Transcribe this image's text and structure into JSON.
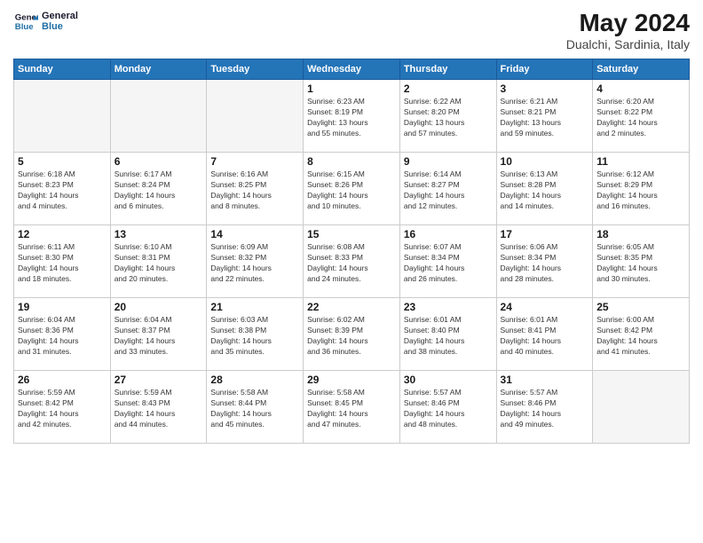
{
  "logo": {
    "line1": "General",
    "line2": "Blue"
  },
  "title": "May 2024",
  "location": "Dualchi, Sardinia, Italy",
  "days_of_week": [
    "Sunday",
    "Monday",
    "Tuesday",
    "Wednesday",
    "Thursday",
    "Friday",
    "Saturday"
  ],
  "weeks": [
    [
      {
        "day": "",
        "info": ""
      },
      {
        "day": "",
        "info": ""
      },
      {
        "day": "",
        "info": ""
      },
      {
        "day": "1",
        "info": "Sunrise: 6:23 AM\nSunset: 8:19 PM\nDaylight: 13 hours\nand 55 minutes."
      },
      {
        "day": "2",
        "info": "Sunrise: 6:22 AM\nSunset: 8:20 PM\nDaylight: 13 hours\nand 57 minutes."
      },
      {
        "day": "3",
        "info": "Sunrise: 6:21 AM\nSunset: 8:21 PM\nDaylight: 13 hours\nand 59 minutes."
      },
      {
        "day": "4",
        "info": "Sunrise: 6:20 AM\nSunset: 8:22 PM\nDaylight: 14 hours\nand 2 minutes."
      }
    ],
    [
      {
        "day": "5",
        "info": "Sunrise: 6:18 AM\nSunset: 8:23 PM\nDaylight: 14 hours\nand 4 minutes."
      },
      {
        "day": "6",
        "info": "Sunrise: 6:17 AM\nSunset: 8:24 PM\nDaylight: 14 hours\nand 6 minutes."
      },
      {
        "day": "7",
        "info": "Sunrise: 6:16 AM\nSunset: 8:25 PM\nDaylight: 14 hours\nand 8 minutes."
      },
      {
        "day": "8",
        "info": "Sunrise: 6:15 AM\nSunset: 8:26 PM\nDaylight: 14 hours\nand 10 minutes."
      },
      {
        "day": "9",
        "info": "Sunrise: 6:14 AM\nSunset: 8:27 PM\nDaylight: 14 hours\nand 12 minutes."
      },
      {
        "day": "10",
        "info": "Sunrise: 6:13 AM\nSunset: 8:28 PM\nDaylight: 14 hours\nand 14 minutes."
      },
      {
        "day": "11",
        "info": "Sunrise: 6:12 AM\nSunset: 8:29 PM\nDaylight: 14 hours\nand 16 minutes."
      }
    ],
    [
      {
        "day": "12",
        "info": "Sunrise: 6:11 AM\nSunset: 8:30 PM\nDaylight: 14 hours\nand 18 minutes."
      },
      {
        "day": "13",
        "info": "Sunrise: 6:10 AM\nSunset: 8:31 PM\nDaylight: 14 hours\nand 20 minutes."
      },
      {
        "day": "14",
        "info": "Sunrise: 6:09 AM\nSunset: 8:32 PM\nDaylight: 14 hours\nand 22 minutes."
      },
      {
        "day": "15",
        "info": "Sunrise: 6:08 AM\nSunset: 8:33 PM\nDaylight: 14 hours\nand 24 minutes."
      },
      {
        "day": "16",
        "info": "Sunrise: 6:07 AM\nSunset: 8:34 PM\nDaylight: 14 hours\nand 26 minutes."
      },
      {
        "day": "17",
        "info": "Sunrise: 6:06 AM\nSunset: 8:34 PM\nDaylight: 14 hours\nand 28 minutes."
      },
      {
        "day": "18",
        "info": "Sunrise: 6:05 AM\nSunset: 8:35 PM\nDaylight: 14 hours\nand 30 minutes."
      }
    ],
    [
      {
        "day": "19",
        "info": "Sunrise: 6:04 AM\nSunset: 8:36 PM\nDaylight: 14 hours\nand 31 minutes."
      },
      {
        "day": "20",
        "info": "Sunrise: 6:04 AM\nSunset: 8:37 PM\nDaylight: 14 hours\nand 33 minutes."
      },
      {
        "day": "21",
        "info": "Sunrise: 6:03 AM\nSunset: 8:38 PM\nDaylight: 14 hours\nand 35 minutes."
      },
      {
        "day": "22",
        "info": "Sunrise: 6:02 AM\nSunset: 8:39 PM\nDaylight: 14 hours\nand 36 minutes."
      },
      {
        "day": "23",
        "info": "Sunrise: 6:01 AM\nSunset: 8:40 PM\nDaylight: 14 hours\nand 38 minutes."
      },
      {
        "day": "24",
        "info": "Sunrise: 6:01 AM\nSunset: 8:41 PM\nDaylight: 14 hours\nand 40 minutes."
      },
      {
        "day": "25",
        "info": "Sunrise: 6:00 AM\nSunset: 8:42 PM\nDaylight: 14 hours\nand 41 minutes."
      }
    ],
    [
      {
        "day": "26",
        "info": "Sunrise: 5:59 AM\nSunset: 8:42 PM\nDaylight: 14 hours\nand 42 minutes."
      },
      {
        "day": "27",
        "info": "Sunrise: 5:59 AM\nSunset: 8:43 PM\nDaylight: 14 hours\nand 44 minutes."
      },
      {
        "day": "28",
        "info": "Sunrise: 5:58 AM\nSunset: 8:44 PM\nDaylight: 14 hours\nand 45 minutes."
      },
      {
        "day": "29",
        "info": "Sunrise: 5:58 AM\nSunset: 8:45 PM\nDaylight: 14 hours\nand 47 minutes."
      },
      {
        "day": "30",
        "info": "Sunrise: 5:57 AM\nSunset: 8:46 PM\nDaylight: 14 hours\nand 48 minutes."
      },
      {
        "day": "31",
        "info": "Sunrise: 5:57 AM\nSunset: 8:46 PM\nDaylight: 14 hours\nand 49 minutes."
      },
      {
        "day": "",
        "info": ""
      }
    ]
  ]
}
